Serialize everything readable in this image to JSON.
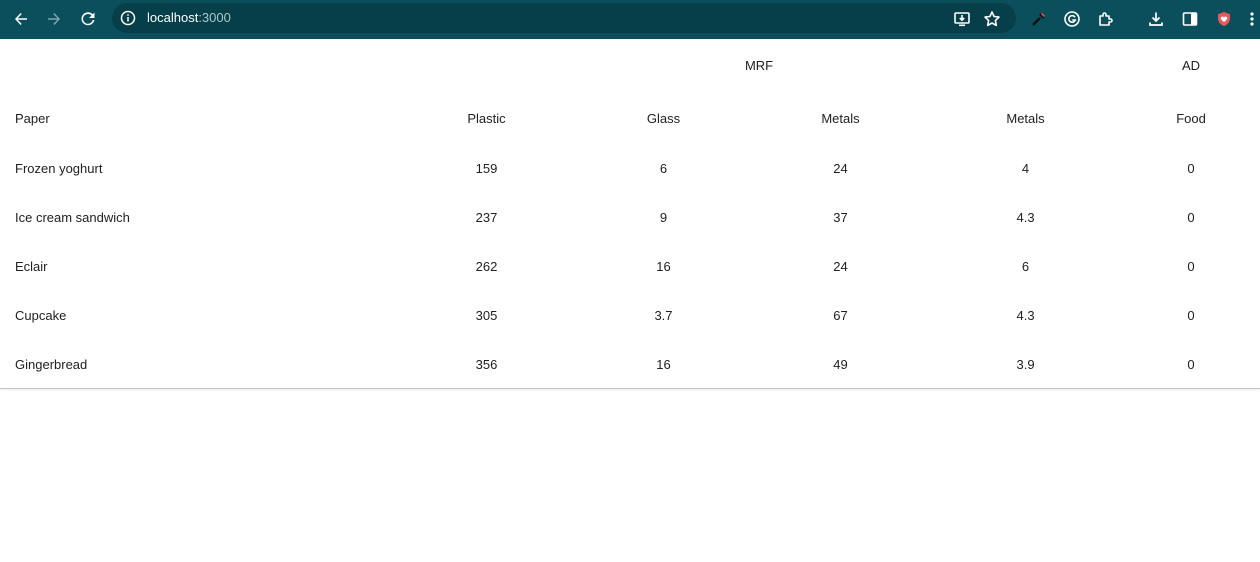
{
  "browser": {
    "url_host": "localhost",
    "url_port": ":3000",
    "toolbar_color": "#0b4f5c",
    "icons": [
      "back-arrow-icon",
      "forward-arrow-icon",
      "reload-icon",
      "site-info-icon",
      "install-app-icon",
      "bookmark-star-icon",
      "eyedropper-icon",
      "grammarly-icon",
      "extensions-puzzle-icon",
      "download-icon",
      "side-panel-icon",
      "shield-heart-icon",
      "more-menu-icon"
    ]
  },
  "table": {
    "group_headers": {
      "mrf": "MRF",
      "ad": "AD"
    },
    "columns": [
      "Paper",
      "Plastic",
      "Glass",
      "Metals",
      "Metals",
      "Food"
    ],
    "rows": [
      [
        "Frozen yoghurt",
        "159",
        "6",
        "24",
        "4",
        "0"
      ],
      [
        "Ice cream sandwich",
        "237",
        "9",
        "37",
        "4.3",
        "0"
      ],
      [
        "Eclair",
        "262",
        "16",
        "24",
        "6",
        "0"
      ],
      [
        "Cupcake",
        "305",
        "3.7",
        "67",
        "4.3",
        "0"
      ],
      [
        "Gingerbread",
        "356",
        "16",
        "49",
        "3.9",
        "0"
      ]
    ]
  }
}
